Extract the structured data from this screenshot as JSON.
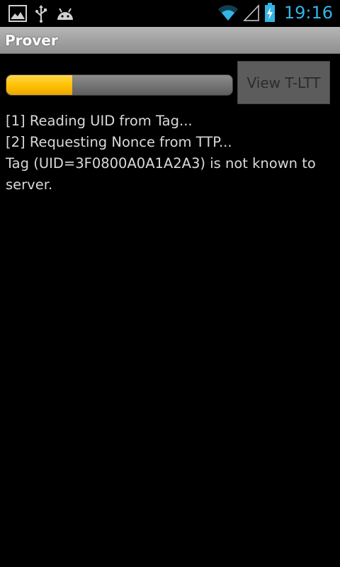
{
  "status_bar": {
    "time": "19:16",
    "icons": {
      "left": [
        "image-icon",
        "usb-icon",
        "android-icon"
      ],
      "right": [
        "wifi-icon",
        "signal-icon",
        "battery-charging-icon"
      ]
    },
    "clock_color": "#33b5e5"
  },
  "title_bar": {
    "title": "Prover"
  },
  "progress": {
    "fraction": 0.29,
    "fill_color": "#ffbf00"
  },
  "button": {
    "label": "View T-LTT"
  },
  "log": {
    "lines": [
      "[1] Reading UID from Tag...",
      "[2] Requesting Nonce from TTP...",
      "Tag (UID=3F0800A0A1A2A3) is not known to server."
    ]
  }
}
